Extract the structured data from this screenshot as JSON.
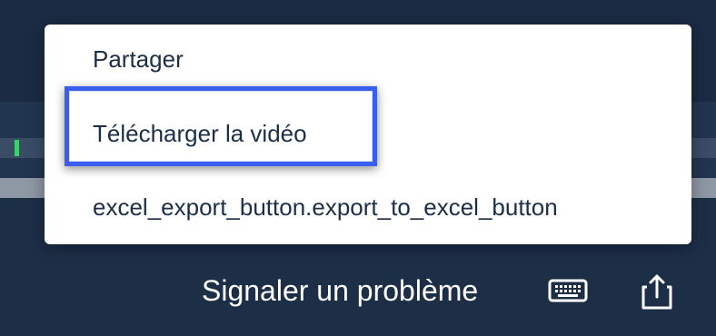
{
  "menu": {
    "items": [
      {
        "label": "Partager"
      },
      {
        "label": "Télécharger la vidéo"
      },
      {
        "label": "excel_export_button.export_to_excel_button"
      }
    ],
    "focused_item_index": 1
  },
  "footer": {
    "report_label": "Signaler un problème",
    "icons": [
      "keyboard-icon",
      "share-icon"
    ]
  },
  "colors": {
    "background": "#1d2e47",
    "menu_background": "#ffffff",
    "menu_text": "#1d2e47",
    "focus_ring": "#3a5ef0",
    "green_marker": "#3ccf6b"
  }
}
